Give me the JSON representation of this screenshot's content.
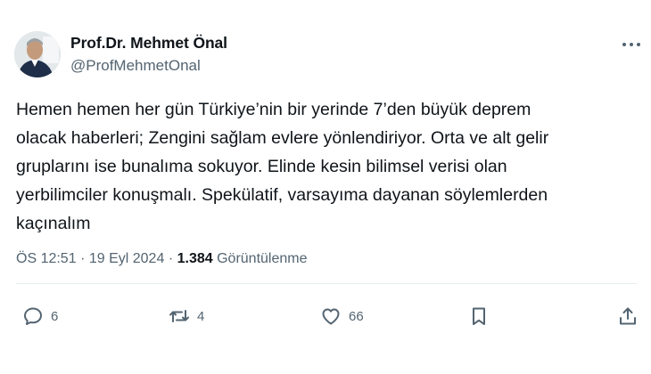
{
  "author": {
    "display_name": "Prof.Dr. Mehmet Önal",
    "handle": "@ProfMehmetOnal"
  },
  "tweet": {
    "text": "Hemen hemen her gün Türkiye’nin bir yerinde 7’den büyük deprem\nolacak haberleri; Zengini sağlam evlere yönlendiriyor. Orta ve alt gelir\ngruplarını ise bunalıma sokuyor. Elinde kesin bilimsel verisi olan\nyerbilimciler konuşmalı. Spekülatif, varsayıma dayanan söylemlerden\nkaçınalım"
  },
  "meta": {
    "time": "ÖS 12:51",
    "separator": "·",
    "date": "19 Eyl 2024",
    "views_count": "1.384",
    "views_label": "Görüntülenme"
  },
  "actions": {
    "reply_count": "6",
    "retweet_count": "4",
    "like_count": "66"
  },
  "colors": {
    "text": "#0f1419",
    "secondary": "#536471",
    "divider": "#e7ecef"
  }
}
